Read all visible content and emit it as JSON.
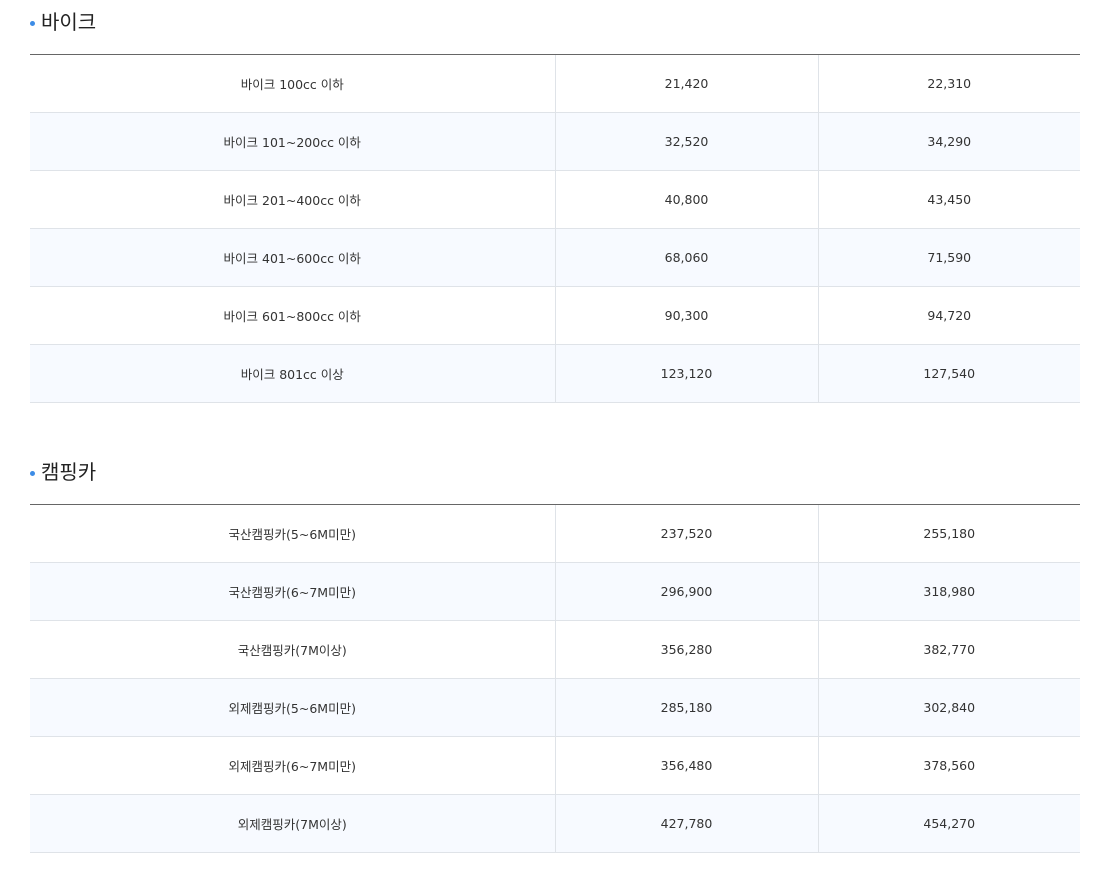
{
  "sections": [
    {
      "title": "바이크",
      "rows": [
        {
          "name": "바이크 100cc 이하",
          "v1": "21,420",
          "v2": "22,310"
        },
        {
          "name": "바이크 101~200cc 이하",
          "v1": "32,520",
          "v2": "34,290"
        },
        {
          "name": "바이크 201~400cc 이하",
          "v1": "40,800",
          "v2": "43,450"
        },
        {
          "name": "바이크 401~600cc 이하",
          "v1": "68,060",
          "v2": "71,590"
        },
        {
          "name": "바이크 601~800cc 이하",
          "v1": "90,300",
          "v2": "94,720"
        },
        {
          "name": "바이크 801cc 이상",
          "v1": "123,120",
          "v2": "127,540"
        }
      ]
    },
    {
      "title": "캠핑카",
      "rows": [
        {
          "name": "국산캠핑카(5~6M미만)",
          "v1": "237,520",
          "v2": "255,180"
        },
        {
          "name": "국산캠핑카(6~7M미만)",
          "v1": "296,900",
          "v2": "318,980"
        },
        {
          "name": "국산캠핑카(7M이상)",
          "v1": "356,280",
          "v2": "382,770"
        },
        {
          "name": "외제캠핑카(5~6M미만)",
          "v1": "285,180",
          "v2": "302,840"
        },
        {
          "name": "외제캠핑카(6~7M미만)",
          "v1": "356,480",
          "v2": "378,560"
        },
        {
          "name": "외제캠핑카(7M이상)",
          "v1": "427,780",
          "v2": "454,270"
        }
      ]
    }
  ],
  "colors": {
    "bullet": "#3d8ce6",
    "stripe": "#f7faff",
    "border": "#dfe3e8",
    "title_line": "#666666"
  }
}
